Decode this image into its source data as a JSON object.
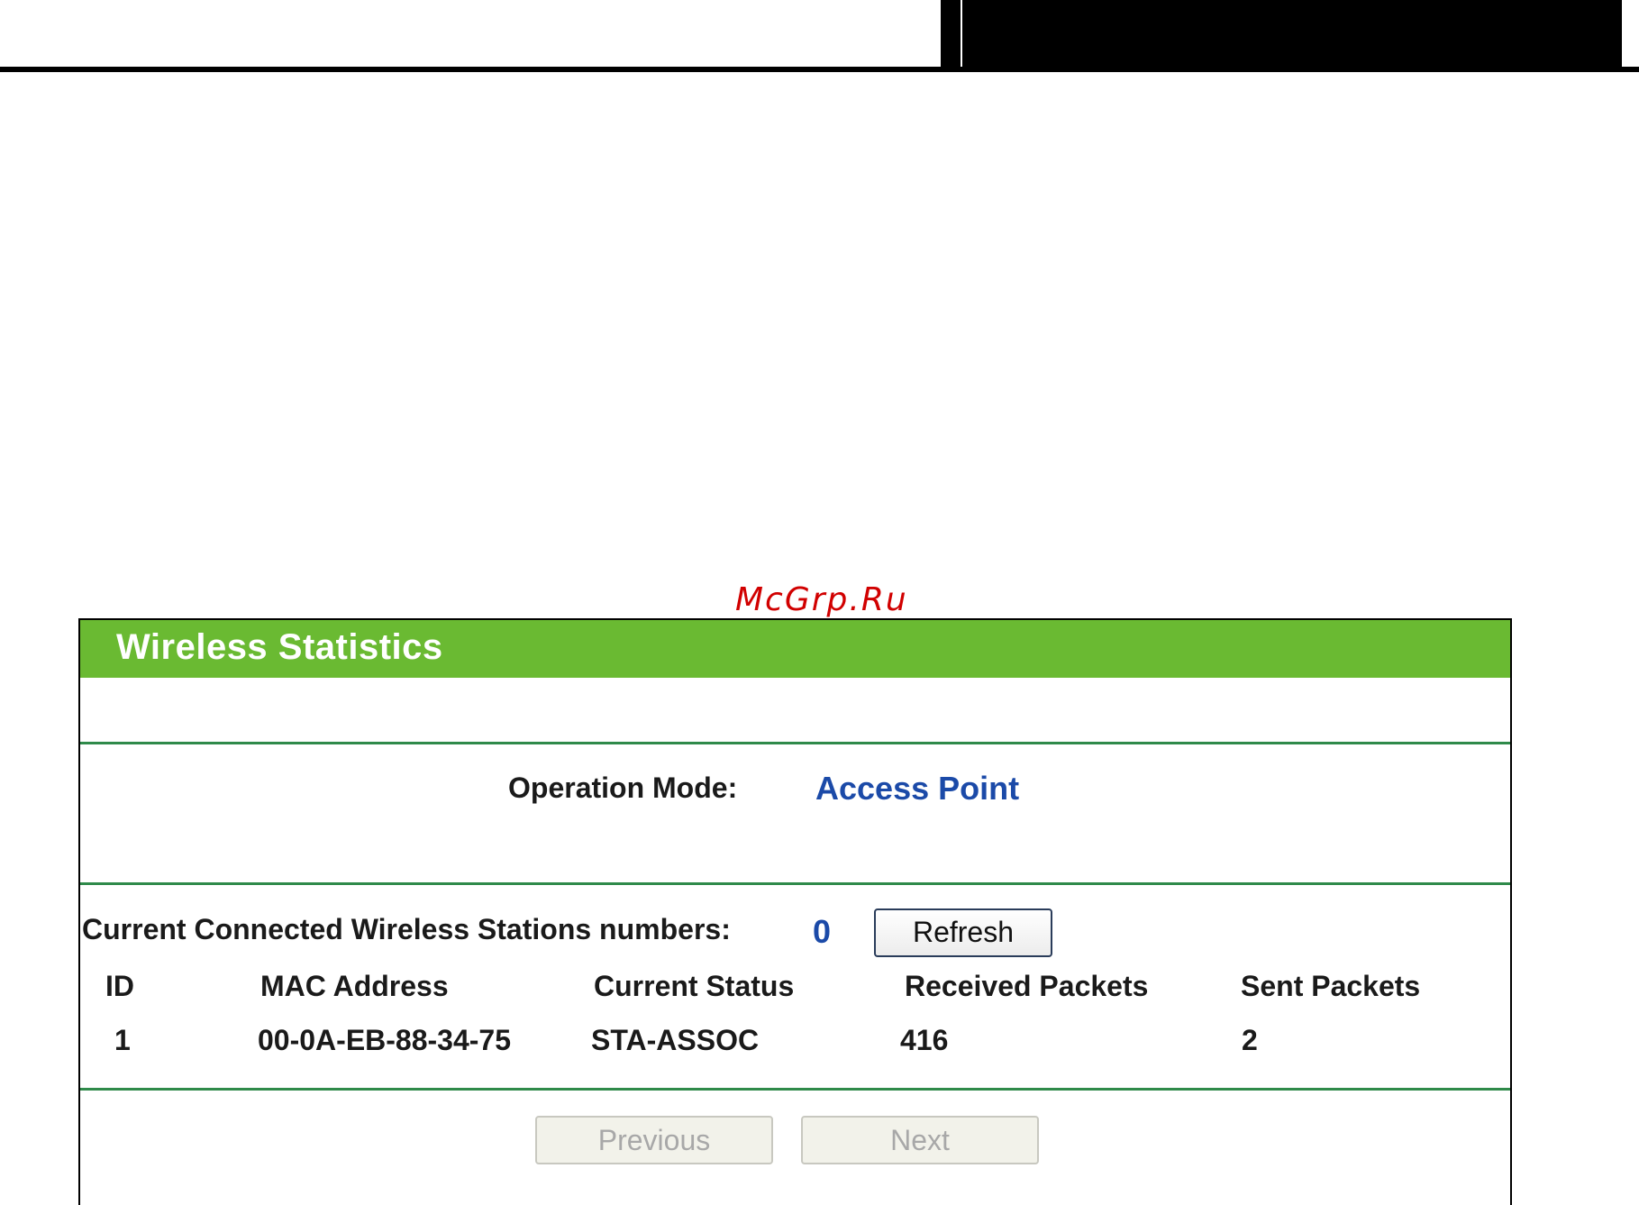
{
  "watermark": "McGrp.Ru",
  "panel": {
    "title": "Wireless Statistics",
    "operation_mode_label": "Operation Mode:",
    "operation_mode_value": "Access Point",
    "stations_label": "Current Connected Wireless Stations numbers:",
    "stations_count": "0",
    "refresh_label": "Refresh",
    "table": {
      "headers": [
        "ID",
        "MAC Address",
        "Current Status",
        "Received Packets",
        "Sent Packets"
      ],
      "rows": [
        [
          "1",
          "00-0A-EB-88-34-75",
          "STA-ASSOC",
          "416",
          "2"
        ]
      ]
    },
    "previous_label": "Previous",
    "next_label": "Next"
  },
  "colors": {
    "header_green": "#6aba32",
    "divider_green": "#2f8a4a",
    "value_blue": "#1b4aa8",
    "watermark_red": "#d10000"
  }
}
